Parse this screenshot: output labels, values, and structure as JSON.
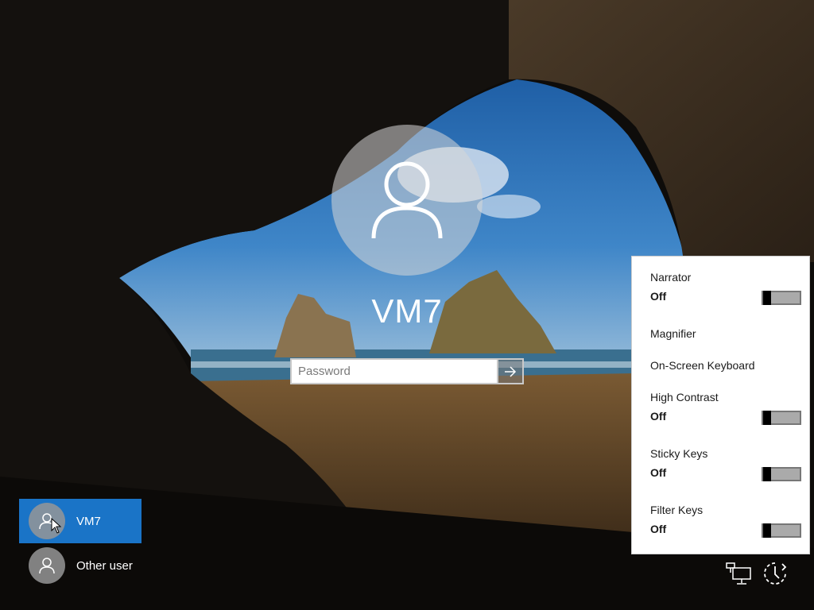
{
  "login": {
    "username": "VM7",
    "password_placeholder": "Password"
  },
  "user_list": [
    {
      "label": "VM7",
      "selected": true
    },
    {
      "label": "Other user",
      "selected": false
    }
  ],
  "ease_of_access": {
    "items": [
      {
        "title": "Narrator",
        "state": "Off",
        "has_toggle": true
      },
      {
        "title": "Magnifier",
        "has_toggle": false
      },
      {
        "title": "On-Screen Keyboard",
        "has_toggle": false
      },
      {
        "title": "High Contrast",
        "state": "Off",
        "has_toggle": true
      },
      {
        "title": "Sticky Keys",
        "state": "Off",
        "has_toggle": true
      },
      {
        "title": "Filter Keys",
        "state": "Off",
        "has_toggle": true
      }
    ]
  },
  "tray": {
    "icons": [
      "network-icon",
      "ease-of-access-icon"
    ]
  },
  "colors": {
    "selected_user_tile": "#1a74c7",
    "panel_bg": "#ffffff"
  }
}
